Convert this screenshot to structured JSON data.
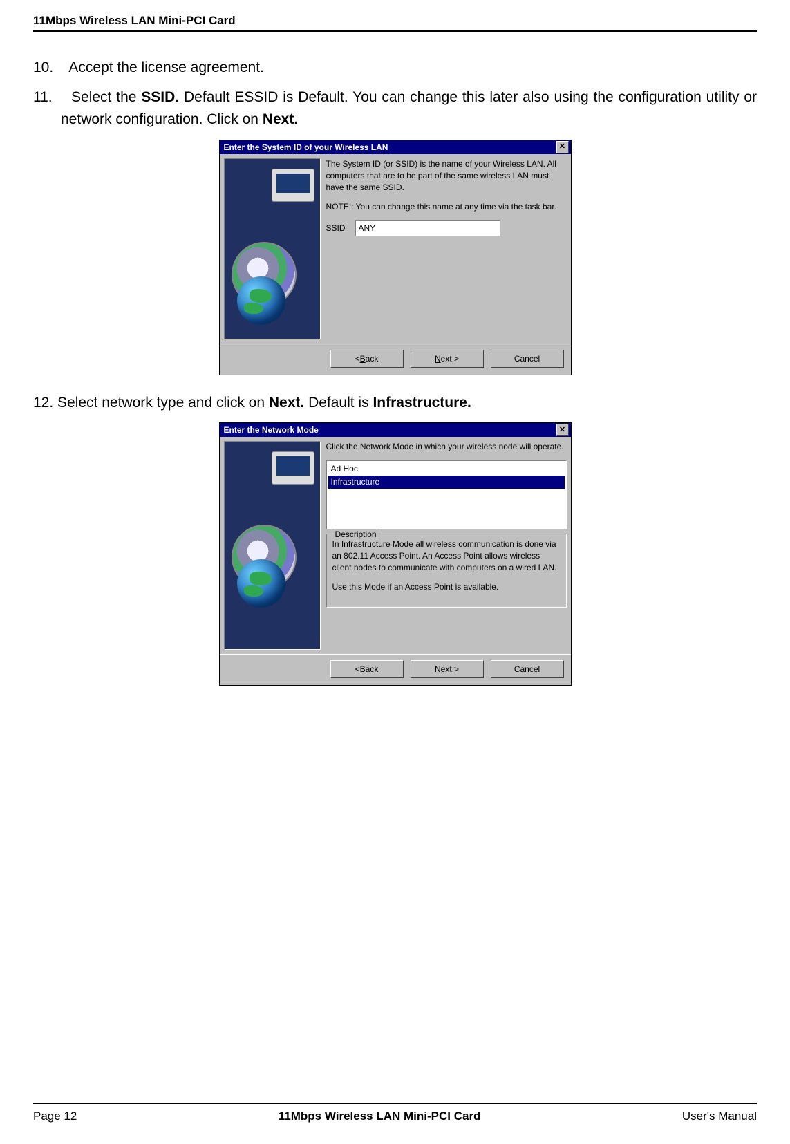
{
  "header": {
    "product": "11Mbps Wireless LAN Mini-PCI Card"
  },
  "steps": {
    "s10_num": "10.",
    "s10_txt": " Accept the license agreement.",
    "s11_num": "11.",
    "s11_a": "Select the ",
    "s11_b_bold": "SSID.",
    "s11_c": "  Default ESSID is Default. You can change this later also using the configuration utility or network configuration.  Click on ",
    "s11_d_bold": "Next.",
    "s12_a": "12. Select network type and click on ",
    "s12_b_bold": "Next.",
    "s12_c": "  Default is ",
    "s12_d_bold": "Infrastructure."
  },
  "dialog1": {
    "title": "Enter the System ID of your Wireless LAN",
    "close_glyph": "✕",
    "para": "The System ID (or SSID) is the name of your Wireless LAN.  All computers that are to be part of the same wireless LAN must have the same SSID.",
    "note": "NOTE!: You can change this name at any time via the task bar.",
    "ssid_label": "SSID",
    "ssid_value": "ANY",
    "back_pre": "< ",
    "back_u": "B",
    "back_post": "ack",
    "next_u": "N",
    "next_post": "ext >",
    "cancel": "Cancel"
  },
  "dialog2": {
    "title": "Enter the Network Mode",
    "close_glyph": "✕",
    "intro": "Click the Network Mode in which your wireless node will operate.",
    "opt_adhoc": "Ad Hoc",
    "opt_infra": "Infrastructure",
    "legend": "Description",
    "desc1": "In Infrastructure Mode all wireless communication is done via an 802.11 Access Point.  An Access Point allows wireless client nodes to communicate with computers on a wired LAN.",
    "desc2": "Use this Mode if an Access Point is available.",
    "back_pre": "< ",
    "back_u": "B",
    "back_post": "ack",
    "next_u": "N",
    "next_post": "ext >",
    "cancel": "Cancel"
  },
  "footer": {
    "left": "Page 12",
    "mid": "11Mbps Wireless LAN Mini-PCI Card",
    "right": "User's Manual"
  }
}
